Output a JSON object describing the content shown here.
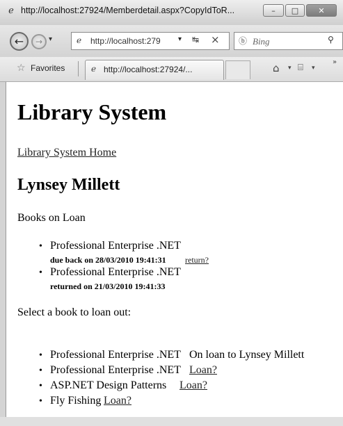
{
  "window": {
    "title": "http://localhost:27924/Memberdetail.aspx?CopyIdToR...",
    "minimize": "–",
    "maximize": "□",
    "close": "✕"
  },
  "navigation": {
    "back": "←",
    "forward": "→",
    "history_dropdown": "▾",
    "address": "http://localhost:279",
    "address_dropdown": "▾",
    "compat": "↹",
    "stop": "×",
    "search_placeholder": "Bing"
  },
  "favorites_bar": {
    "favorites_label": "Favorites",
    "tab_label": "http://localhost:27924/...",
    "home": "⌂",
    "dropdown": "▾",
    "feeds": "⌸",
    "more": "»"
  },
  "page": {
    "heading": "Library System",
    "home_link": "Library System Home",
    "member_name": "Lynsey Millett",
    "loans_heading": "Books on Loan",
    "loans": [
      {
        "title": "Professional Enterprise .NET",
        "status": "due back on 28/03/2010 19:41:31",
        "action": "return?"
      },
      {
        "title": "Professional Enterprise .NET",
        "status": "returned on 21/03/2010 19:41:33"
      }
    ],
    "select_heading": "Select a book to loan out:",
    "books": [
      {
        "title": "Professional Enterprise .NET",
        "note": "On loan to Lynsey Millett"
      },
      {
        "title": "Professional Enterprise .NET",
        "action": "Loan?"
      },
      {
        "title": "ASP.NET Design Patterns",
        "action": "Loan?"
      },
      {
        "title": "Fly Fishing",
        "action": "Loan?"
      }
    ]
  }
}
